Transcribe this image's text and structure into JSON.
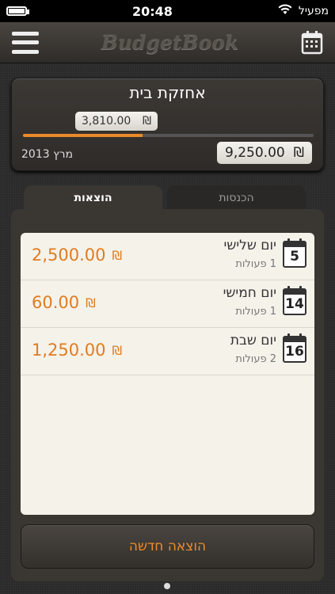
{
  "status": {
    "carrier": "מפעיל",
    "time": "20:48"
  },
  "nav": {
    "title": "BudgetBook"
  },
  "budget": {
    "title": "אחזקת בית",
    "spent_amount": "3,810.00",
    "spent_currency": "₪",
    "total_amount": "9,250.00",
    "total_currency": "₪",
    "period": "מרץ 2013",
    "progress_fraction": 0.412,
    "accent_color": "#e98a2a"
  },
  "tabs": {
    "expenses": "הוצאות",
    "income": "הכנסות",
    "active": "expenses"
  },
  "days": [
    {
      "day_number": "5",
      "name": "יום שלישי",
      "count": "1 פעולות",
      "amount": "2,500.00",
      "currency": "₪"
    },
    {
      "day_number": "14",
      "name": "יום חמישי",
      "count": "1 פעולות",
      "amount": "60.00",
      "currency": "₪"
    },
    {
      "day_number": "16",
      "name": "יום שבת",
      "count": "2 פעולות",
      "amount": "1,250.00",
      "currency": "₪"
    }
  ],
  "actions": {
    "add_expense": "הוצאה חדשה"
  },
  "icons": {
    "menu": "menu-icon",
    "calendar": "calendar-icon",
    "wifi": "wifi-icon",
    "battery": "battery-icon"
  }
}
